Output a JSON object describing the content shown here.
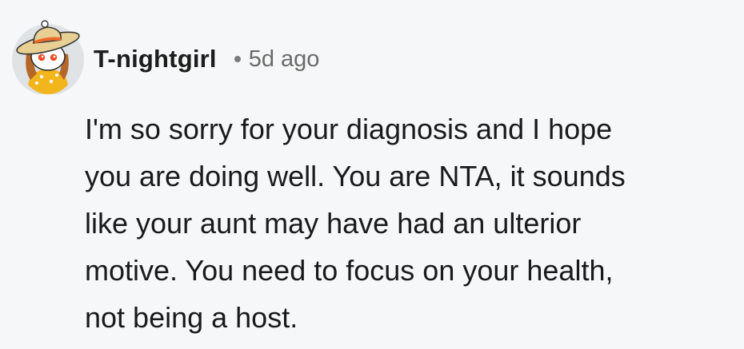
{
  "comment": {
    "author": "T-nightgirl",
    "separator": "•",
    "timestamp": "5d ago",
    "avatar_icon": "snoo-avatar-sunhat-icon",
    "body_lines": [
      "I'm so sorry for your diagnosis and I hope",
      "you are doing well. You are NTA, it sounds",
      "like your aunt may have had an ulterior",
      "motive. You need to focus on your health,",
      "not being a host."
    ]
  },
  "colors": {
    "background": "#f6f7f8",
    "text": "#1c1c1c",
    "meta": "#6a6a6a",
    "avatar_bg": "#dfe3e6",
    "hat": "#e8cf93",
    "hat_band": "#ee6a2a",
    "shirt": "#f2b51c"
  }
}
